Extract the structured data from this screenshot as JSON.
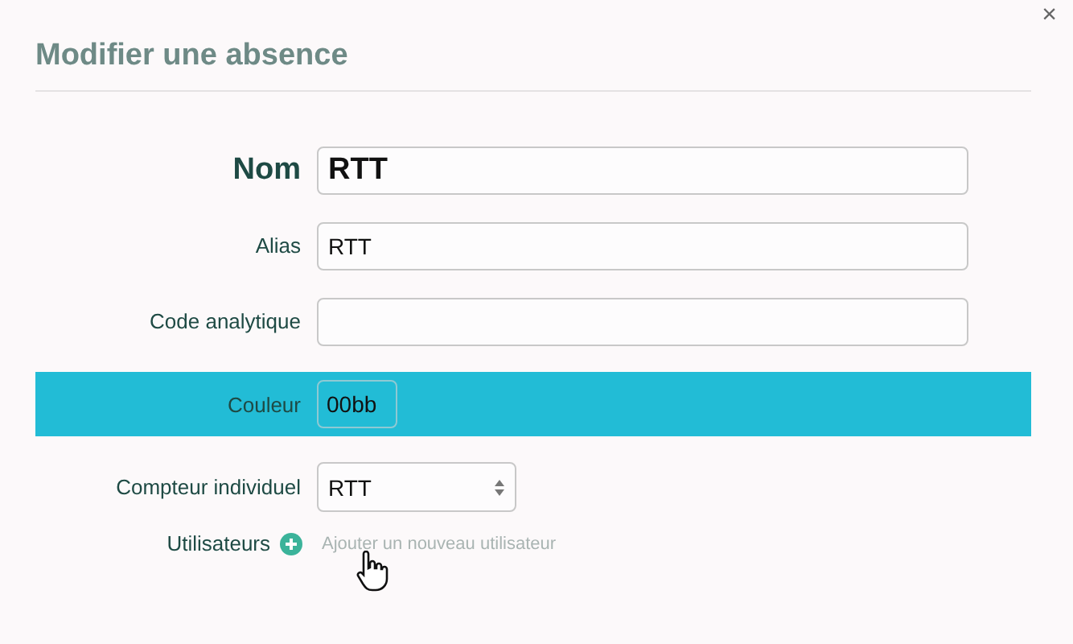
{
  "dialog": {
    "title": "Modifier une absence",
    "close": "×"
  },
  "fields": [
    {
      "kind": "text",
      "label": "Nom",
      "value": "RTT",
      "emphasis": true,
      "highlighted": false
    },
    {
      "kind": "text",
      "label": "Alias",
      "value": "RTT",
      "emphasis": false,
      "highlighted": false
    },
    {
      "kind": "text",
      "label": "Code analytique",
      "emphasis": false,
      "highlighted": false
    },
    {
      "kind": "color",
      "label": "Couleur",
      "value": "00bb",
      "emphasis": false,
      "highlighted": true
    },
    {
      "kind": "select",
      "label": "Compteur individuel",
      "value": "RTT",
      "emphasis": false,
      "highlighted": false
    }
  ],
  "users": {
    "label": "Utilisateurs",
    "link": "Ajouter un nouveau utilisateur"
  }
}
